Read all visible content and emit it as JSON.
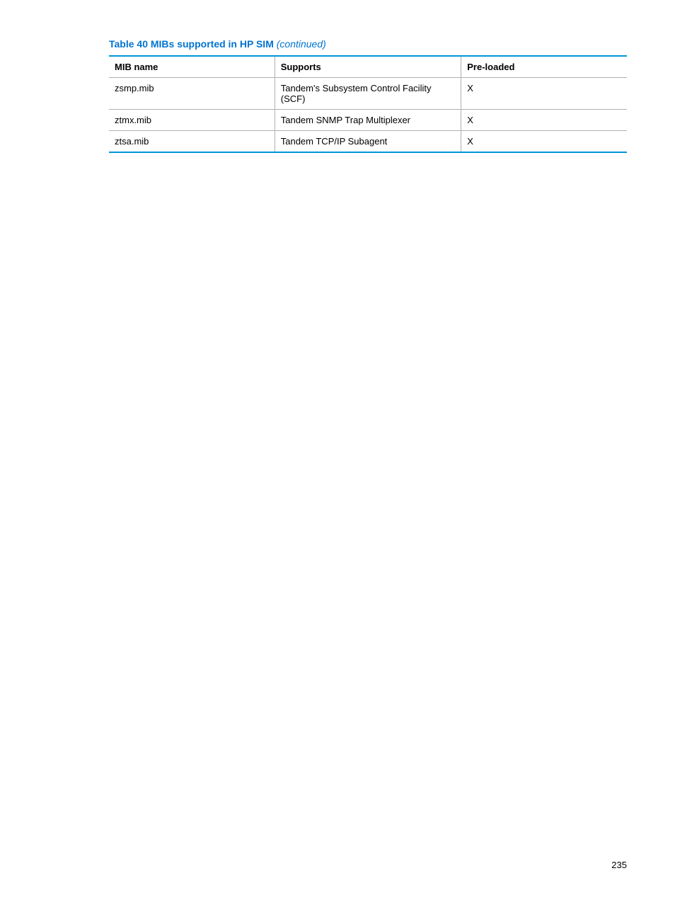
{
  "title": {
    "main": "Table 40 MIBs supported in HP SIM",
    "continued": "(continued)"
  },
  "headers": {
    "col1": "MIB name",
    "col2": "Supports",
    "col3": "Pre-loaded"
  },
  "rows": [
    {
      "mib_name": "zsmp.mib",
      "supports": "Tandem's Subsystem Control Facility (SCF)",
      "preloaded": "X"
    },
    {
      "mib_name": "ztmx.mib",
      "supports": "Tandem SNMP Trap Multiplexer",
      "preloaded": "X"
    },
    {
      "mib_name": "ztsa.mib",
      "supports": "Tandem TCP/IP Subagent",
      "preloaded": "X"
    }
  ],
  "page_number": "235"
}
